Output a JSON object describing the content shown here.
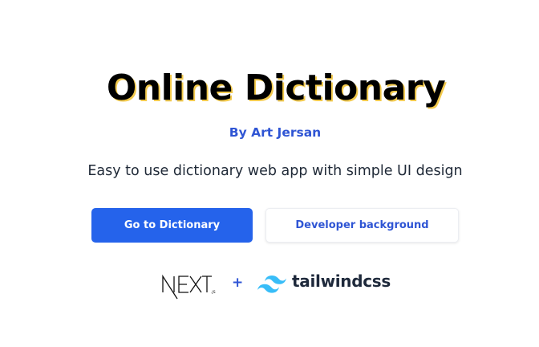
{
  "hero": {
    "title": "Online Dictionary",
    "author": "By Art Jersan",
    "tagline": "Easy to use dictionary web app with simple UI design"
  },
  "actions": {
    "primary_label": "Go to Dictionary",
    "secondary_label": "Developer background"
  },
  "tech": {
    "next_logo": "NEXT.js",
    "separator": "+",
    "tailwind_icon": "tailwind-wave-icon",
    "tailwind_label": "tailwindcss"
  },
  "colors": {
    "primary": "#2563eb",
    "accent_text": "#2f55d4",
    "title_shadow": "#f2c94c",
    "tailwind": "#38bdf8"
  }
}
